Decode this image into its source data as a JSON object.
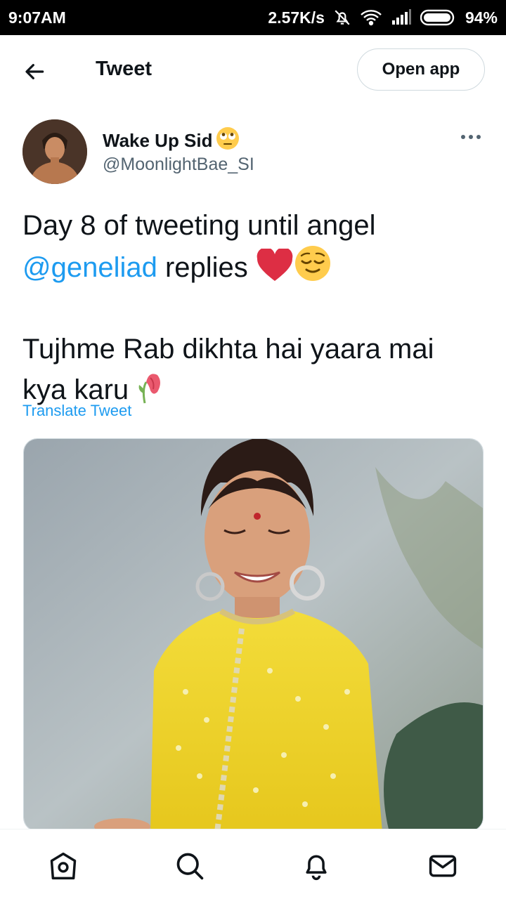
{
  "status_bar": {
    "time": "9:07AM",
    "speed": "2.57K/s",
    "battery": "94%",
    "icons": [
      "mute-icon",
      "wifi-icon",
      "signal-icon",
      "battery-icon"
    ]
  },
  "header": {
    "title": "Tweet",
    "open_app_label": "Open app"
  },
  "tweet": {
    "display_name": "Wake Up Sid",
    "handle": "@MoonlightBae_SI",
    "line1": "Day 8 of tweeting until angel",
    "mention": "@geneliad",
    "line2_rest": " replies ",
    "line3": "Tujhme Rab dikhta hai yaara mai",
    "line4": "kya karu ",
    "translate_label": "Translate Tweet",
    "emojis": [
      "rolling-eyes-emoji",
      "red-heart-emoji",
      "relieved-emoji",
      "wilted-flower-emoji"
    ]
  },
  "media": {
    "icon": "photo-woman-yellow-outfit"
  },
  "bottom_nav": {
    "items": [
      "home-icon",
      "search-icon",
      "notifications-icon",
      "messages-icon"
    ]
  },
  "colors": {
    "accent": "#1d9bf0",
    "text": "#0f1419",
    "secondary_text": "#536471",
    "border": "#cfd9de"
  }
}
